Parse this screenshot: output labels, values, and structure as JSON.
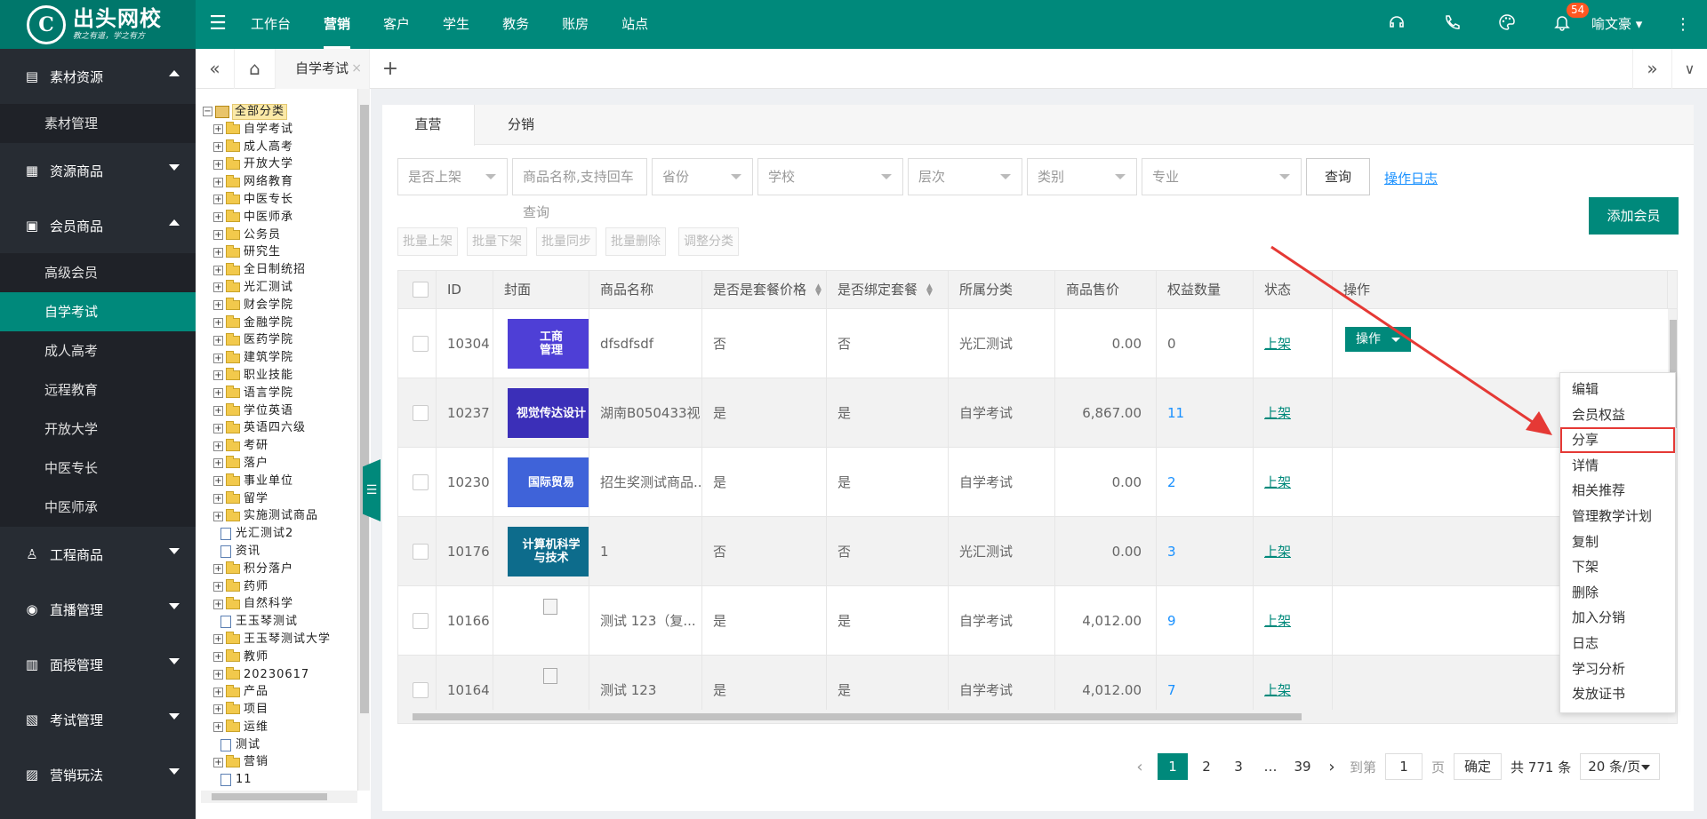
{
  "brand": {
    "logo_glyph": "C",
    "name": "出头网校",
    "slogan": "教之有道，学之有方"
  },
  "top_nav": {
    "items": [
      "工作台",
      "营销",
      "客户",
      "学生",
      "教务",
      "账房",
      "站点"
    ],
    "active_index": 1
  },
  "header": {
    "notify_count": "54",
    "user_name": "喻文豪"
  },
  "sidebar": {
    "items": [
      {
        "type": "group",
        "label": "素材资源",
        "icon": "file-doc-icon",
        "expanded": true
      },
      {
        "type": "sub",
        "label": "素材管理"
      },
      {
        "type": "group",
        "label": "资源商品",
        "icon": "resource-icon",
        "expanded": false
      },
      {
        "type": "group",
        "label": "会员商品",
        "icon": "member-icon",
        "expanded": true
      },
      {
        "type": "sub",
        "label": "高级会员"
      },
      {
        "type": "sub",
        "label": "自学考试",
        "active": true
      },
      {
        "type": "sub",
        "label": "成人高考"
      },
      {
        "type": "sub",
        "label": "远程教育"
      },
      {
        "type": "sub",
        "label": "开放大学"
      },
      {
        "type": "sub",
        "label": "中医专长"
      },
      {
        "type": "sub",
        "label": "中医师承"
      },
      {
        "type": "group",
        "label": "工程商品",
        "icon": "user-icon",
        "expanded": false
      },
      {
        "type": "group",
        "label": "直播管理",
        "icon": "live-icon",
        "expanded": false
      },
      {
        "type": "group",
        "label": "面授管理",
        "icon": "classroom-icon",
        "expanded": false
      },
      {
        "type": "group",
        "label": "考试管理",
        "icon": "exam-icon",
        "expanded": false
      },
      {
        "type": "group",
        "label": "营销玩法",
        "icon": "marketing-icon",
        "expanded": false
      }
    ]
  },
  "tabbar": {
    "active_tab": "自学考试",
    "close_glyph": "×"
  },
  "tree": {
    "root": "全部分类",
    "nodes": [
      {
        "label": "自学考试",
        "kind": "folder"
      },
      {
        "label": "成人高考",
        "kind": "folder"
      },
      {
        "label": "开放大学",
        "kind": "folder"
      },
      {
        "label": "网络教育",
        "kind": "folder"
      },
      {
        "label": "中医专长",
        "kind": "folder"
      },
      {
        "label": "中医师承",
        "kind": "folder"
      },
      {
        "label": "公务员",
        "kind": "folder"
      },
      {
        "label": "研究生",
        "kind": "folder"
      },
      {
        "label": "全日制统招",
        "kind": "folder"
      },
      {
        "label": "光汇测试",
        "kind": "folder"
      },
      {
        "label": "财会学院",
        "kind": "folder"
      },
      {
        "label": "金融学院",
        "kind": "folder"
      },
      {
        "label": "医药学院",
        "kind": "folder"
      },
      {
        "label": "建筑学院",
        "kind": "folder"
      },
      {
        "label": "职业技能",
        "kind": "folder"
      },
      {
        "label": "语言学院",
        "kind": "folder"
      },
      {
        "label": "学位英语",
        "kind": "folder"
      },
      {
        "label": "英语四六级",
        "kind": "folder"
      },
      {
        "label": "考研",
        "kind": "folder"
      },
      {
        "label": "落户",
        "kind": "folder"
      },
      {
        "label": "事业单位",
        "kind": "folder"
      },
      {
        "label": "留学",
        "kind": "folder"
      },
      {
        "label": "实施测试商品",
        "kind": "folder"
      },
      {
        "label": "光汇测试2",
        "kind": "page"
      },
      {
        "label": "资讯",
        "kind": "page"
      },
      {
        "label": "积分落户",
        "kind": "folder"
      },
      {
        "label": "药师",
        "kind": "folder"
      },
      {
        "label": "自然科学",
        "kind": "folder"
      },
      {
        "label": "王玉琴测试",
        "kind": "page"
      },
      {
        "label": "王玉琴测试大学",
        "kind": "folder"
      },
      {
        "label": "教师",
        "kind": "folder"
      },
      {
        "label": "20230617",
        "kind": "folder"
      },
      {
        "label": "产品",
        "kind": "folder"
      },
      {
        "label": "项目",
        "kind": "folder"
      },
      {
        "label": "运维",
        "kind": "folder"
      },
      {
        "label": "测试",
        "kind": "page"
      },
      {
        "label": "营销",
        "kind": "folder"
      },
      {
        "label": "11",
        "kind": "page"
      }
    ]
  },
  "tabs": {
    "direct": "直营",
    "distribution": "分销"
  },
  "filters": {
    "on_shelf": "是否上架",
    "name_placeholder": "商品名称,支持回车查询",
    "province": "省份",
    "school": "学校",
    "level": "层次",
    "category": "类别",
    "major": "专业",
    "search_button": "查询",
    "log_link": "操作日志"
  },
  "add_member_button": "添加会员",
  "batch_buttons": [
    "批量上架",
    "批量下架",
    "批量同步",
    "批量删除",
    "调整分类"
  ],
  "table": {
    "columns": [
      "ID",
      "封面",
      "商品名称",
      "是否是套餐价格",
      "是否绑定套餐",
      "所属分类",
      "商品售价",
      "权益数量",
      "状态",
      "操作"
    ],
    "op_label": "操作",
    "rows": [
      {
        "id": "10304",
        "cover": {
          "text": "工商\n管理",
          "bg": "#4e3fd6"
        },
        "name": "dfsdfsdf",
        "is_package_price": "否",
        "is_bound": "否",
        "category": "光汇测试",
        "price": "0.00",
        "benefits": "0",
        "benefits_link": false,
        "status": "上架"
      },
      {
        "id": "10237",
        "cover": {
          "text": "视觉传达设计",
          "bg": "#3b2fb8"
        },
        "name": "湖南B050433视...",
        "is_package_price": "是",
        "is_bound": "是",
        "category": "自学考试",
        "price": "6,867.00",
        "benefits": "11",
        "benefits_link": true,
        "status": "上架"
      },
      {
        "id": "10230",
        "cover": {
          "text": "国际贸易",
          "bg": "#3f63d9"
        },
        "name": "招生奖测试商品...",
        "is_package_price": "是",
        "is_bound": "是",
        "category": "自学考试",
        "price": "0.00",
        "benefits": "2",
        "benefits_link": true,
        "status": "上架"
      },
      {
        "id": "10176",
        "cover": {
          "text": "计算机科学\n与技术",
          "bg": "#0d6c8c"
        },
        "name": "1",
        "is_package_price": "否",
        "is_bound": "否",
        "category": "光汇测试",
        "price": "0.00",
        "benefits": "3",
        "benefits_link": true,
        "status": "上架"
      },
      {
        "id": "10166",
        "cover": null,
        "name": "测试   123（复...",
        "is_package_price": "是",
        "is_bound": "是",
        "category": "自学考试",
        "price": "4,012.00",
        "benefits": "9",
        "benefits_link": true,
        "status": "上架"
      },
      {
        "id": "10164",
        "cover": null,
        "name": "测试   123",
        "is_package_price": "是",
        "is_bound": "是",
        "category": "自学考试",
        "price": "4,012.00",
        "benefits": "7",
        "benefits_link": true,
        "status": "上架"
      }
    ]
  },
  "dropdown": {
    "items": [
      "编辑",
      "会员权益",
      "分享",
      "详情",
      "相关推荐",
      "管理教学计划",
      "复制",
      "下架",
      "删除",
      "加入分销",
      "日志",
      "学习分析",
      "发放证书"
    ],
    "highlighted": "分享"
  },
  "pagination": {
    "pages": [
      "1",
      "2",
      "3"
    ],
    "ellipsis": "…",
    "last": "39",
    "goto_label": "到第",
    "goto_value": "1",
    "page_unit": "页",
    "confirm": "确定",
    "total": "共 771 条",
    "page_size": "20 条/页"
  },
  "colors": {
    "primary": "#00897b",
    "sidebar": "#272c33",
    "link": "#1890ff",
    "annotation": "#e53935"
  }
}
